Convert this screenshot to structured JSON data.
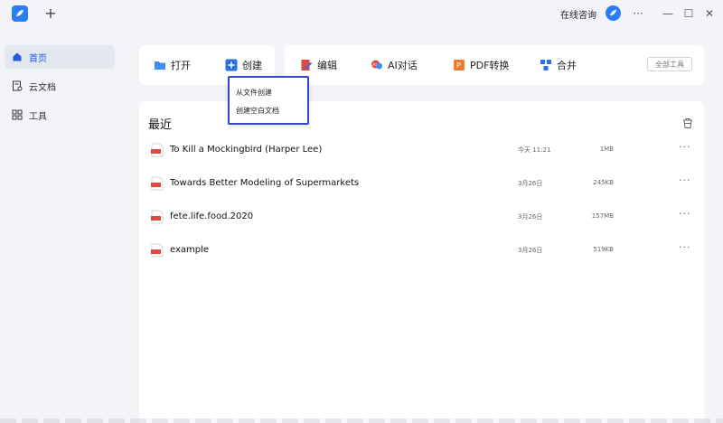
{
  "titlebar": {
    "consult_label": "在线咨询",
    "new_tab": "+",
    "more": "···",
    "minimize": "—",
    "maximize": "☐",
    "close": "✕"
  },
  "sidebar": {
    "items": [
      {
        "label": "首页",
        "icon": "home-icon",
        "active": true
      },
      {
        "label": "云文档",
        "icon": "cloud-doc-icon",
        "active": false
      },
      {
        "label": "工具",
        "icon": "tools-grid-icon",
        "active": false
      }
    ]
  },
  "toolbar": {
    "open_label": "打开",
    "create_label": "创建",
    "edit_label": "编辑",
    "ai_label": "AI对话",
    "convert_label": "PDF转换",
    "merge_label": "合并",
    "all_tools_label": "全部工具"
  },
  "create_menu": {
    "items": [
      "从文件创建",
      "创建空白文档"
    ]
  },
  "recent": {
    "title": "最近",
    "files": [
      {
        "name": "To Kill a Mockingbird (Harper Lee)",
        "date": "今天 11:21",
        "size": "1MB",
        "more": "···"
      },
      {
        "name": "Towards Better Modeling of Supermarkets",
        "date": "3月26日",
        "size": "245KB",
        "more": "···"
      },
      {
        "name": "fete.life.food.2020",
        "date": "3月26日",
        "size": "157MB",
        "more": "···"
      },
      {
        "name": "example",
        "date": "3月26日",
        "size": "519KB",
        "more": "···"
      }
    ]
  },
  "colors": {
    "accent": "#2a7ef5",
    "active_text": "#1e5bd6",
    "dropdown_border": "#3547c9",
    "pdf_red": "#e0483d"
  }
}
